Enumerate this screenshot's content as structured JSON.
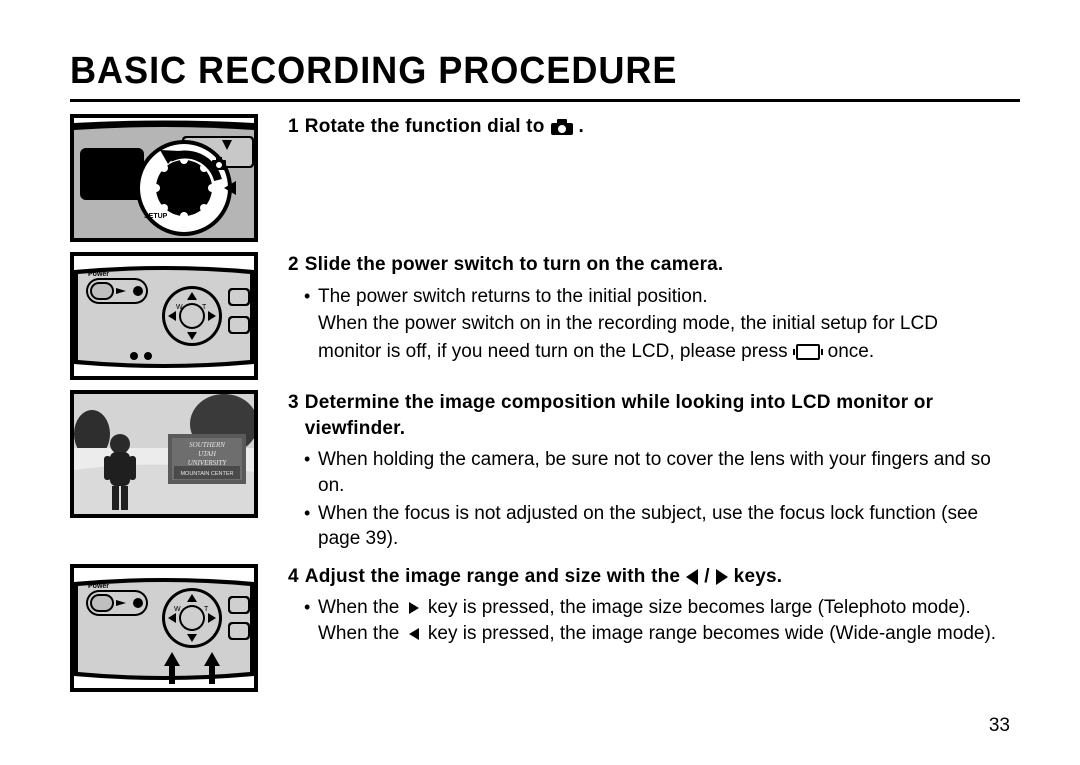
{
  "title": "BASIC RECORDING PROCEDURE",
  "page_number": "33",
  "steps": [
    {
      "num": "1",
      "head_pre": "Rotate the function dial to",
      "head_post": "."
    },
    {
      "num": "2",
      "head": "Slide the power switch to turn on the camera.",
      "bullet1": "The power switch returns to the initial position.",
      "cont1": "When the power switch on in the recording mode, the initial setup for LCD",
      "cont2_pre": "monitor is off, if you need turn on the LCD, please press",
      "cont2_post": "once."
    },
    {
      "num": "3",
      "head": "Determine the image composition while looking into LCD monitor or viewfinder.",
      "bullet1": "When holding the camera, be sure not to cover the lens with your fingers and so on.",
      "bullet2": "When the focus is not adjusted on the subject, use the focus lock function (see page 39)."
    },
    {
      "num": "4",
      "head_pre": "Adjust the image range and size with the",
      "head_mid": "/",
      "head_post": "keys.",
      "bullet1_pre": "When the",
      "bullet1_mid": "key is pressed, the image size becomes large (Telephoto mode). When the",
      "bullet1_post": "key is pressed, the image range becomes wide (Wide-angle mode)."
    }
  ],
  "power_label": "Power",
  "photo_sign": {
    "line1": "SOUTHERN",
    "line2": "UTAH",
    "line3": "UNIVERSITY",
    "line4": "MOUNTAIN CENTER"
  }
}
